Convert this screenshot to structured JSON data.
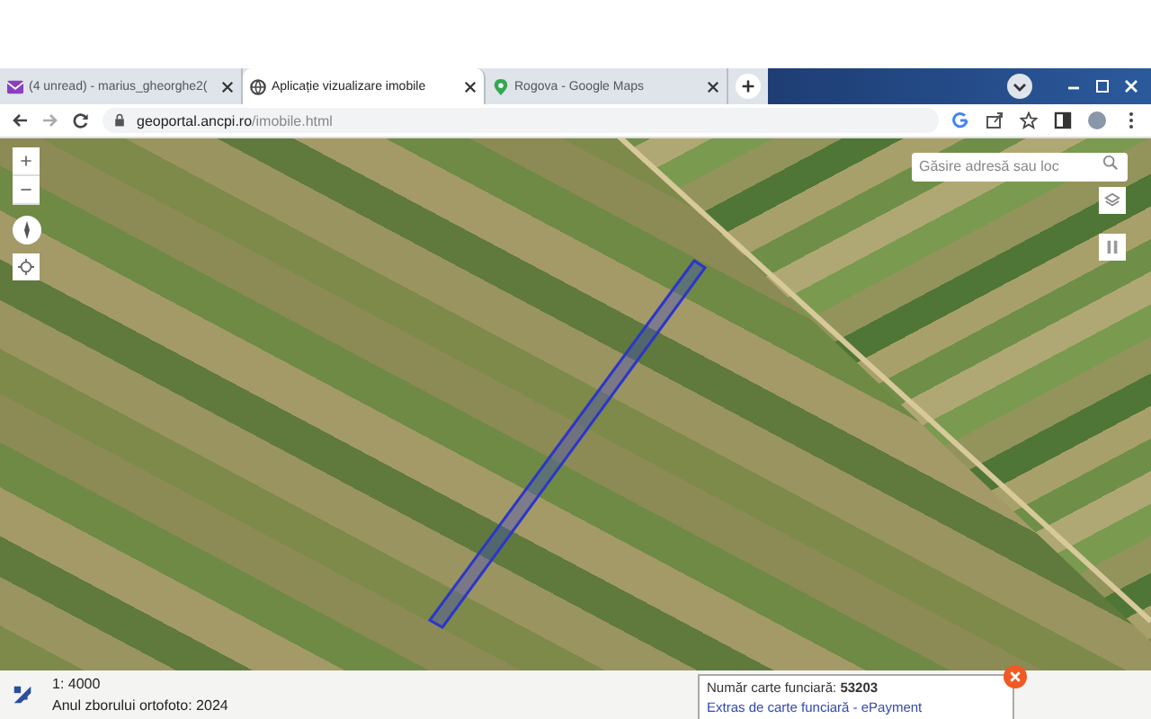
{
  "browser": {
    "tabs": [
      {
        "title": "(4 unread) - marius_gheorghe2(",
        "kind": "mail",
        "selected": false
      },
      {
        "title": "Aplicație vizualizare imobile",
        "kind": "globe",
        "selected": true
      },
      {
        "title": "Rogova - Google Maps",
        "kind": "maps",
        "selected": false
      }
    ],
    "address": {
      "host": "geoportal.ancpi.ro",
      "path": "/imobile.html"
    }
  },
  "map": {
    "search": {
      "placeholder": "Găsire adresă sau loc"
    }
  },
  "popup": {
    "label": "Număr carte funciară: **53203**",
    "link": "Extras de carte funciară - ePayment"
  },
  "footer": {
    "scale": "1: 4000",
    "ortho_year": "Anul zborului ortofoto: 2024"
  }
}
